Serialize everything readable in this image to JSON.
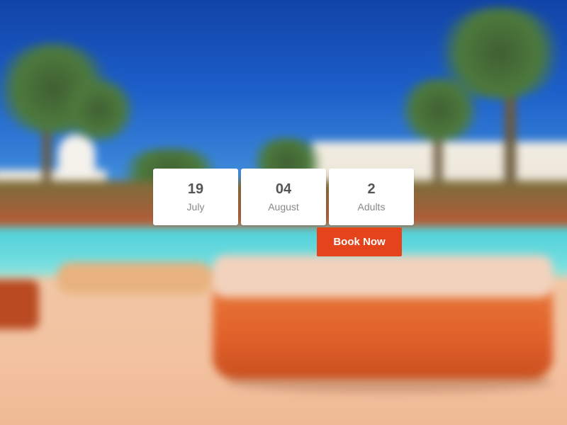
{
  "booking": {
    "fields": [
      {
        "value": "19",
        "label": "July"
      },
      {
        "value": "04",
        "label": "August"
      },
      {
        "value": "2",
        "label": "Adults"
      }
    ],
    "book_label": "Book Now"
  },
  "colors": {
    "accent": "#e5431b",
    "card_bg": "#ffffff",
    "value_text": "#555555",
    "label_text": "#888888"
  }
}
